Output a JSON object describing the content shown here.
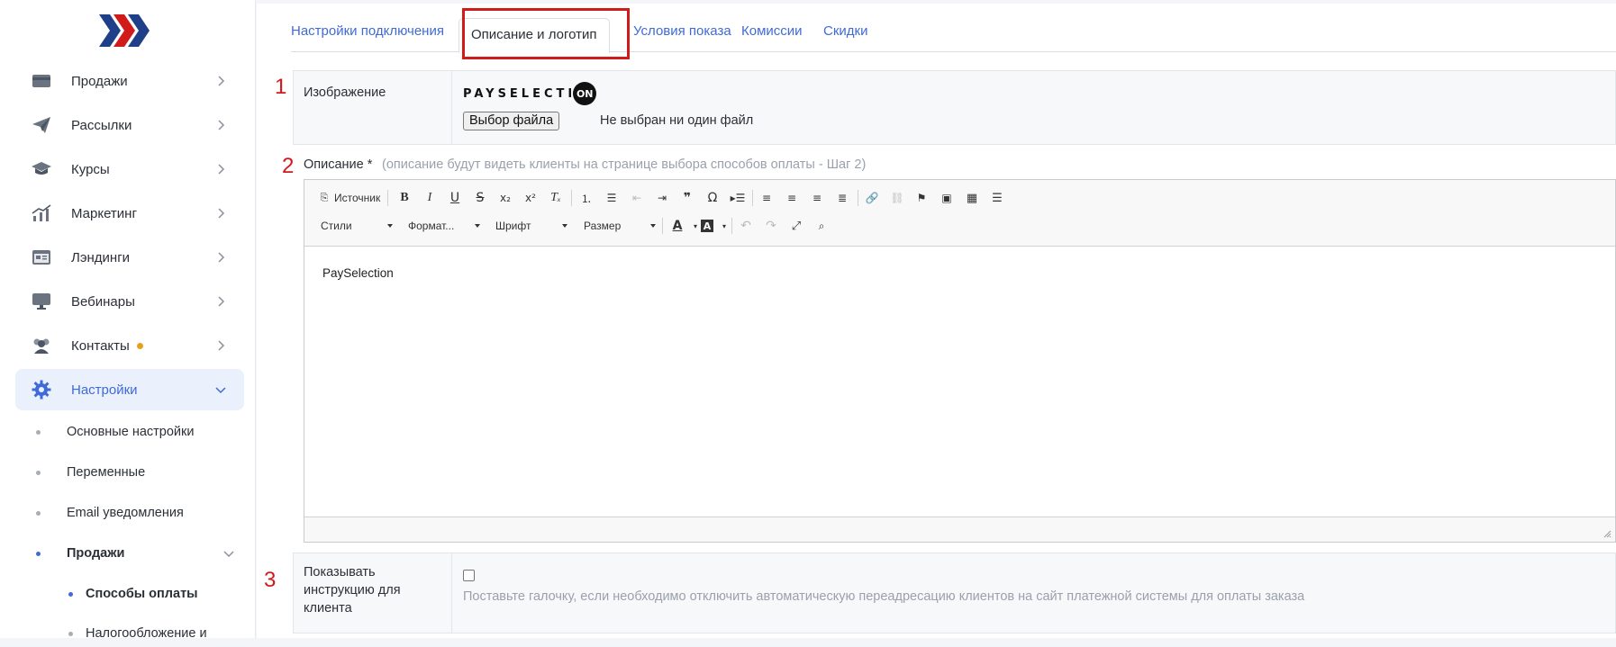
{
  "sidebar": {
    "items": [
      {
        "label": "Продажи",
        "icon": "wallet-icon"
      },
      {
        "label": "Рассылки",
        "icon": "paper-plane-icon"
      },
      {
        "label": "Курсы",
        "icon": "graduation-cap-icon"
      },
      {
        "label": "Маркетинг",
        "icon": "chart-icon"
      },
      {
        "label": "Лэндинги",
        "icon": "landing-page-icon"
      },
      {
        "label": "Вебинары",
        "icon": "monitor-icon"
      },
      {
        "label": "Контакты",
        "icon": "users-icon"
      },
      {
        "label": "Настройки",
        "icon": "gear-icon"
      }
    ],
    "settings_sub": [
      "Основные настройки",
      "Переменные",
      "Email уведомления",
      "Продажи"
    ],
    "sales_sub": [
      "Способы оплаты",
      "Налогообложение и"
    ]
  },
  "tabs": [
    "Настройки подключения",
    "Описание и логотип",
    "Условия показа",
    "Комиссии",
    "Скидки"
  ],
  "annotations": [
    "1",
    "2",
    "3"
  ],
  "form": {
    "image_label": "Изображение",
    "logo_text": "PAYSELECTI",
    "logo_on": "ON",
    "file_button": "Выбор файла",
    "file_status": "Не выбран ни один файл",
    "description_label": "Описание *",
    "description_hint": "(описание будут видеть клиенты на странице выбора способов оплаты - Шаг 2)",
    "editor": {
      "source_label": "Источник",
      "styles": "Стили",
      "format": "Формат...",
      "font": "Шрифт",
      "size": "Размер",
      "content": "PaySelection"
    },
    "show_instruction_label": "Показывать инструкцию для клиента",
    "show_instruction_hint": "Поставьте галочку, если необходимо отключить автоматическую переадресацию клиентов на сайт платежной системы для оплаты заказа",
    "show_instruction_checked": false
  },
  "colors": {
    "accent": "#3f6ad8",
    "highlight": "#d11a1a",
    "notification": "#e6a11a"
  }
}
